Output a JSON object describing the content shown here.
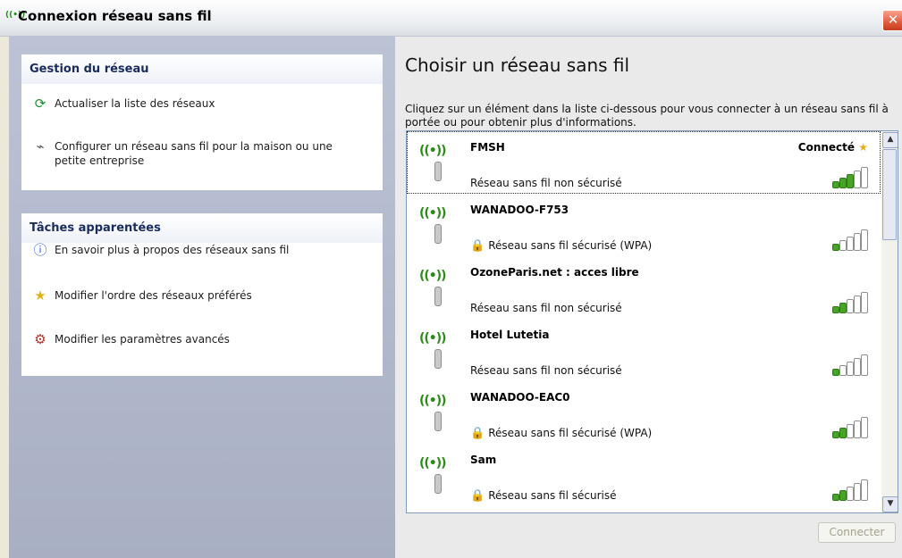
{
  "window": {
    "title": "Connexion réseau sans fil",
    "close_label": "✕"
  },
  "left": {
    "network_tasks": {
      "heading": "Gestion du réseau",
      "items": [
        {
          "label": "Actualiser la liste des réseaux",
          "icon": "refresh-icon"
        },
        {
          "label": "Configurer un réseau sans fil pour la maison ou une petite entreprise",
          "icon": "wireless-setup-icon"
        }
      ]
    },
    "related_tasks": {
      "heading": "Tâches apparentées",
      "items": [
        {
          "label": "En savoir plus à propos des réseaux sans fil",
          "icon": "info-icon"
        },
        {
          "label": "Modifier l'ordre des réseaux préférés",
          "icon": "star-icon"
        },
        {
          "label": "Modifier les paramètres avancés",
          "icon": "settings-icon"
        }
      ]
    }
  },
  "right": {
    "title": "Choisir un réseau sans fil",
    "intro": "Cliquez sur un élément dans la liste ci-dessous pour vous connecter à un réseau sans fil à portée ou pour obtenir plus d'informations.",
    "connect_button": "Connecter",
    "networks": [
      {
        "name": "FMSH",
        "status": "Connecté",
        "description": "Réseau sans fil non sécurisé",
        "secured": false,
        "signal_bars": 3,
        "selected": true
      },
      {
        "name": "WANADOO-F753",
        "status": "",
        "description": "Réseau sans fil sécurisé (WPA)",
        "secured": true,
        "signal_bars": 1,
        "selected": false
      },
      {
        "name": "OzoneParis.net : acces libre",
        "status": "",
        "description": "Réseau sans fil non sécurisé",
        "secured": false,
        "signal_bars": 2,
        "selected": false
      },
      {
        "name": "Hotel Lutetia",
        "status": "",
        "description": "Réseau sans fil non sécurisé",
        "secured": false,
        "signal_bars": 1,
        "selected": false
      },
      {
        "name": "WANADOO-EAC0",
        "status": "",
        "description": "Réseau sans fil sécurisé (WPA)",
        "secured": true,
        "signal_bars": 2,
        "selected": false
      },
      {
        "name": "Sam",
        "status": "",
        "description": "Réseau sans fil sécurisé",
        "secured": true,
        "signal_bars": 2,
        "selected": false
      }
    ]
  },
  "colors": {
    "signal_on": "#46a524",
    "window_bg": "#ece9d8"
  }
}
